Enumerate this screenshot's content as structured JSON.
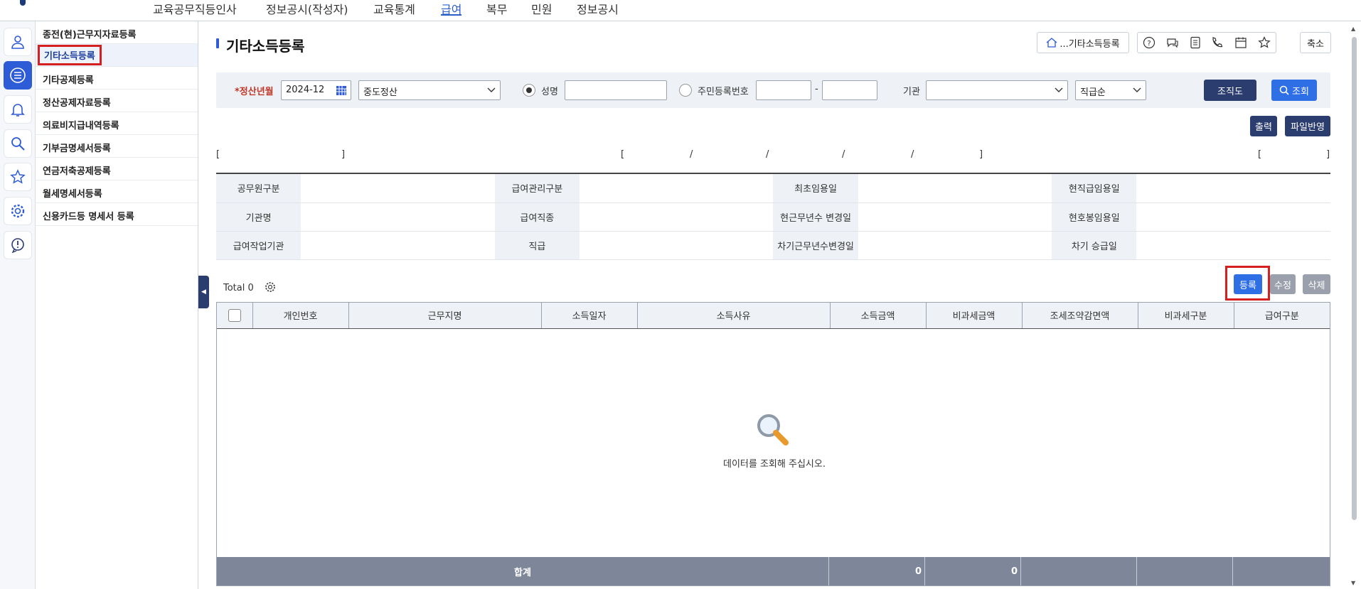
{
  "nav": {
    "items": [
      {
        "label": "교육공무직등인사",
        "active": false
      },
      {
        "label": "정보공시(작성자)",
        "active": false
      },
      {
        "label": "교육통계",
        "active": false
      },
      {
        "label": "급여",
        "active": true
      },
      {
        "label": "복무",
        "active": false
      },
      {
        "label": "민원",
        "active": false
      },
      {
        "label": "정보공시",
        "active": false
      }
    ]
  },
  "rail": {
    "icons": [
      "user-icon",
      "list-icon",
      "bell-icon",
      "search-icon",
      "star-icon",
      "gear-icon",
      "alert-icon"
    ]
  },
  "submenu": {
    "items": [
      {
        "label": "종전(현)근무지자료등록"
      },
      {
        "label": "기타소득등록",
        "active": true
      },
      {
        "label": "기타공제등록"
      },
      {
        "label": "정산공제자료등록"
      },
      {
        "label": "의료비지급내역등록"
      },
      {
        "label": "기부금명세서등록"
      },
      {
        "label": "연금저축공제등록"
      },
      {
        "label": "월세명세서등록"
      },
      {
        "label": "신용카드등 명세서 등록"
      }
    ]
  },
  "page": {
    "title": "기타소득등록",
    "breadcrumb_button": "...기타소득등록",
    "collapse_label": "축소",
    "collapse_handle": "◀"
  },
  "search": {
    "period_label": "*정산년월",
    "period_value": "2024-12",
    "settlement_type": "중도정산",
    "name_label": "성명",
    "name_value": "",
    "rrn_label": "주민등록번호",
    "rrn_dash": "-",
    "org_label": "기관",
    "org_value": "",
    "sort_value": "직급순",
    "org_chart_button": "조직도",
    "search_button": "조회"
  },
  "actions": {
    "print": "출력",
    "file_apply": "파일반영",
    "register": "등록",
    "edit": "수정",
    "delete": "삭제"
  },
  "brackets": {
    "left_open": "[",
    "left_close": "]",
    "mid": [
      "[",
      "/",
      "/",
      "/",
      "/",
      "]"
    ],
    "right_open": "[",
    "right_close": "]"
  },
  "info": {
    "rows": [
      [
        "공무원구분",
        "급여관리구분",
        "최초임용일",
        "현직급임용일"
      ],
      [
        "기관명",
        "급여직종",
        "현근무년수 변경일",
        "현호봉임용일"
      ],
      [
        "급여작업기관",
        "직급",
        "차기근무년수변경일",
        "차기 승급일"
      ]
    ]
  },
  "grid": {
    "total_label": "Total 0",
    "columns": [
      "개인번호",
      "근무지명",
      "소득일자",
      "소득사유",
      "소득금액",
      "비과세금액",
      "조세조약감면액",
      "비과세구분",
      "급여구분"
    ],
    "empty_message": "데이터를 조회해 주십시오.",
    "footer": {
      "label": "합계",
      "income_sum": "0",
      "nontax_sum": "0"
    }
  },
  "colors": {
    "accent": "#2e5bd6",
    "dark": "#2b3c6e",
    "highlight": "#d62020"
  }
}
